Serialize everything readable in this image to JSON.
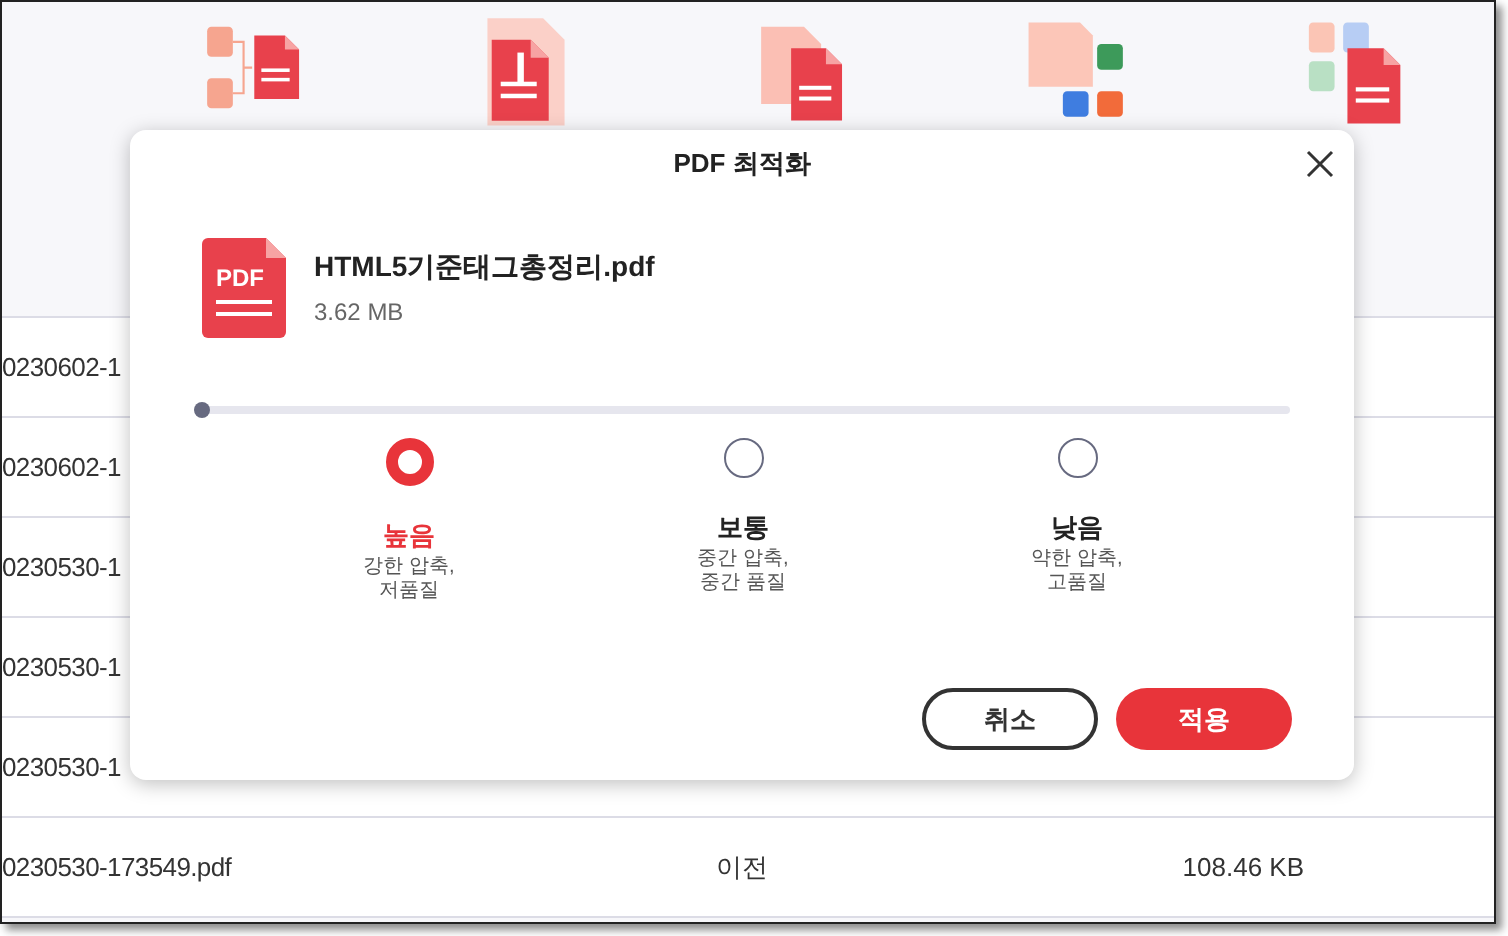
{
  "tools": [
    {
      "kind": "merge"
    },
    {
      "kind": "zip"
    },
    {
      "kind": "ocr"
    },
    {
      "kind": "export"
    },
    {
      "kind": "create"
    }
  ],
  "files": [
    {
      "name": "0230602-1"
    },
    {
      "name": "0230602-1"
    },
    {
      "name": "0230530-1"
    },
    {
      "name": "0230530-1"
    },
    {
      "name": "0230530-1"
    },
    {
      "name": "0230530-173549.pdf",
      "status": "이전",
      "size": "108.46 KB"
    }
  ],
  "dialog": {
    "title": "PDF 최적화",
    "file": {
      "icon_text": "PDF",
      "name": "HTML5기준태그총정리.pdf",
      "size": "3.62 MB"
    },
    "compression": {
      "level": 0
    },
    "options": [
      {
        "label": "높음",
        "description": "강한 압축,\n저품질",
        "selected": true
      },
      {
        "label": "보통",
        "description": "중간 압축,\n중간 품질",
        "selected": false
      },
      {
        "label": "낮음",
        "description": "약한 압축,\n고품질",
        "selected": false
      }
    ],
    "buttons": [
      {
        "label": "취소",
        "kind": "secondary"
      },
      {
        "label": "적용",
        "kind": "primary"
      }
    ]
  }
}
